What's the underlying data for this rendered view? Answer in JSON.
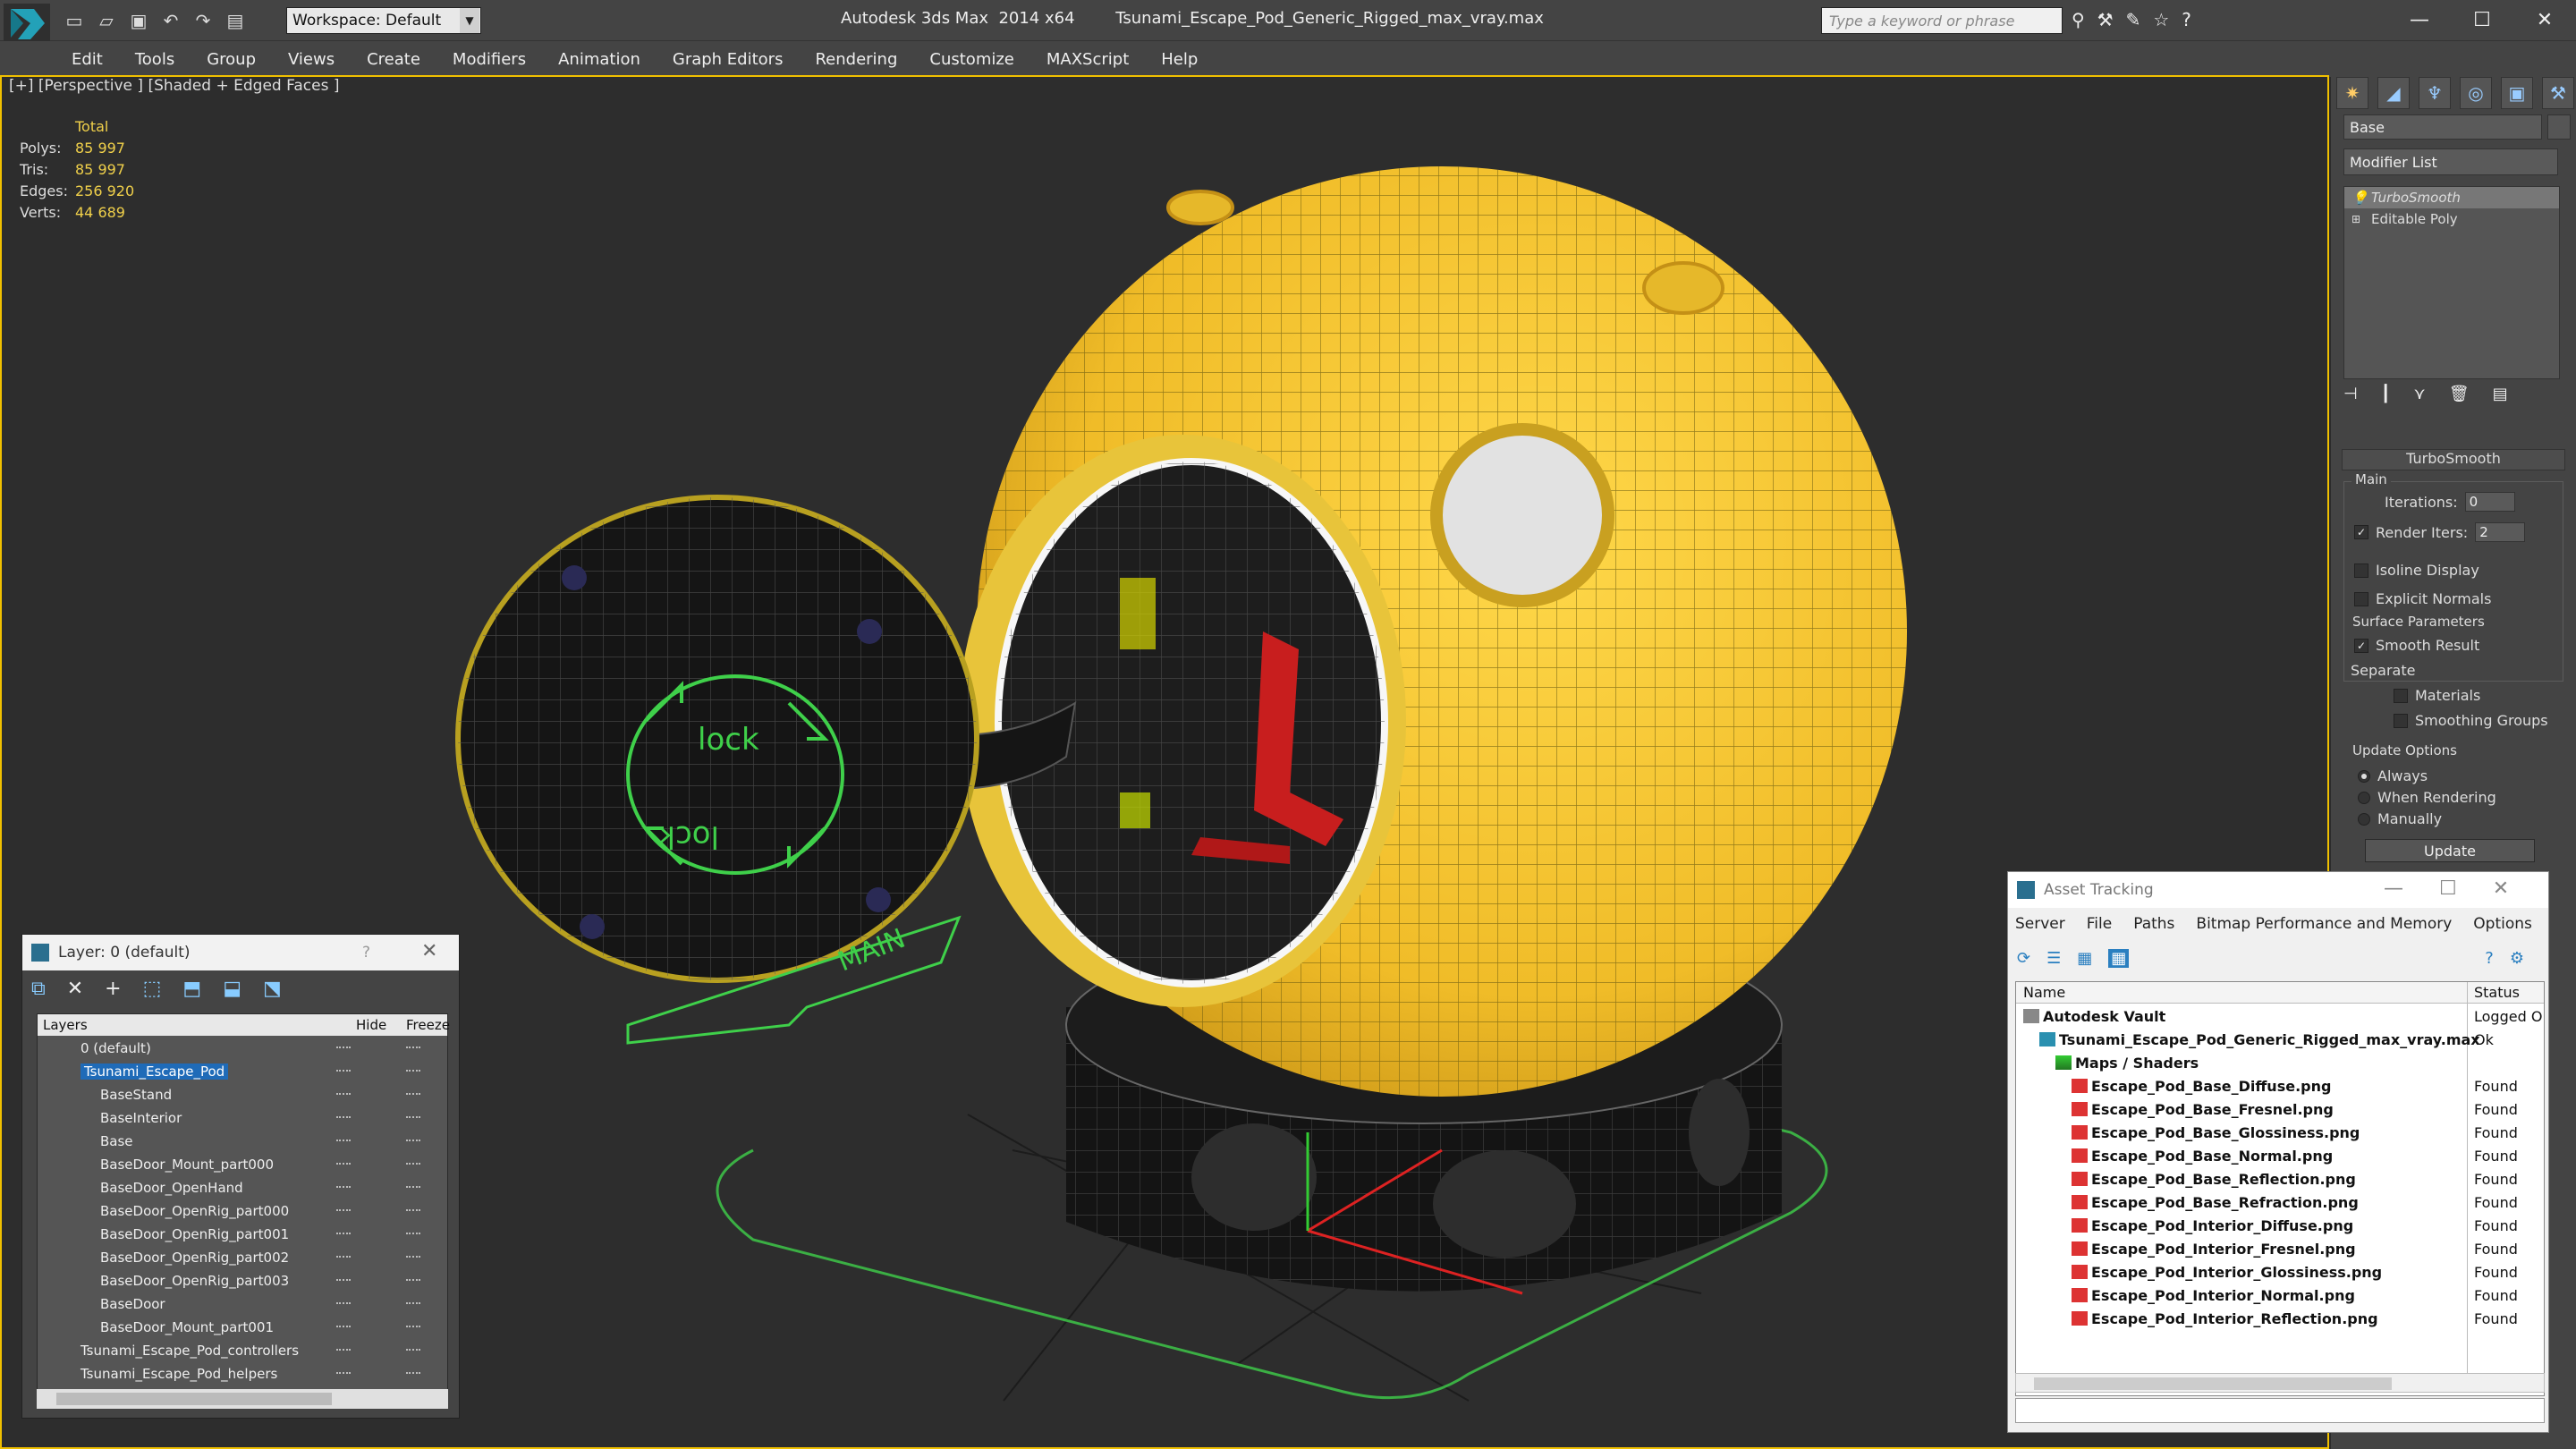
{
  "app": {
    "title": "Autodesk 3ds Max  2014 x64        Tsunami_Escape_Pod_Generic_Rigged_max_vray.max",
    "workspace": "Workspace: Default",
    "search_placeholder": "Type a keyword or phrase"
  },
  "menu": [
    "Edit",
    "Tools",
    "Group",
    "Views",
    "Create",
    "Modifiers",
    "Animation",
    "Graph Editors",
    "Rendering",
    "Customize",
    "MAXScript",
    "Help"
  ],
  "viewport": {
    "label": "[+] [Perspective ] [Shaded + Edged Faces ]",
    "stats_header": "Total",
    "stats": [
      {
        "label": "Polys:",
        "value": "85 997"
      },
      {
        "label": "Tris:",
        "value": "85 997"
      },
      {
        "label": "Edges:",
        "value": "256 920"
      },
      {
        "label": "Verts:",
        "value": "44 689"
      }
    ],
    "lock_top": "lock",
    "lock_bottom": "lock",
    "main_label": "MAIN"
  },
  "command_panel": {
    "object_name": "Base",
    "modifier_list": "Modifier List",
    "stack": [
      "TurboSmooth",
      "Editable Poly"
    ],
    "rollout_title": "TurboSmooth",
    "main_group": "Main",
    "iterations_label": "Iterations:",
    "iterations_value": "0",
    "render_iters_label": "Render Iters:",
    "render_iters_value": "2",
    "isoline": "Isoline Display",
    "explicit_normals": "Explicit Normals",
    "surface_params": "Surface Parameters",
    "smooth_result": "Smooth Result",
    "separate": "Separate",
    "materials": "Materials",
    "smoothing_groups": "Smoothing Groups",
    "update_options": "Update Options",
    "always": "Always",
    "when_rendering": "When Rendering",
    "manually": "Manually",
    "update_button": "Update"
  },
  "layer_window": {
    "title": "Layer: 0 (default)",
    "help": "?",
    "col_layers": "Layers",
    "col_hide": "Hide",
    "col_freeze": "Freeze",
    "rows": [
      {
        "name": "0 (default)",
        "indent": 0
      },
      {
        "name": "Tsunami_Escape_Pod",
        "indent": 0
      },
      {
        "name": "BaseStand",
        "indent": 1
      },
      {
        "name": "BaseInterior",
        "indent": 1
      },
      {
        "name": "Base",
        "indent": 1
      },
      {
        "name": "BaseDoor_Mount_part000",
        "indent": 1
      },
      {
        "name": "BaseDoor_OpenHand",
        "indent": 1
      },
      {
        "name": "BaseDoor_OpenRig_part000",
        "indent": 1
      },
      {
        "name": "BaseDoor_OpenRig_part001",
        "indent": 1
      },
      {
        "name": "BaseDoor_OpenRig_part002",
        "indent": 1
      },
      {
        "name": "BaseDoor_OpenRig_part003",
        "indent": 1
      },
      {
        "name": "BaseDoor",
        "indent": 1
      },
      {
        "name": "BaseDoor_Mount_part001",
        "indent": 1
      },
      {
        "name": "Tsunami_Escape_Pod_controllers",
        "indent": 0
      },
      {
        "name": "Tsunami_Escape_Pod_helpers",
        "indent": 0
      }
    ]
  },
  "asset_window": {
    "title": "Asset Tracking",
    "menu": [
      "Server",
      "File",
      "Paths",
      "Bitmap Performance and Memory",
      "Options"
    ],
    "col_name": "Name",
    "col_status": "Status",
    "rows": [
      {
        "name": "Autodesk Vault",
        "status": "Logged O",
        "icon": "vault",
        "indent": 0,
        "bold": true
      },
      {
        "name": "Tsunami_Escape_Pod_Generic_Rigged_max_vray.max",
        "status": "Ok",
        "icon": "max",
        "indent": 1,
        "bold": true
      },
      {
        "name": "Maps / Shaders",
        "status": "",
        "icon": "folder",
        "indent": 2,
        "bold": true
      },
      {
        "name": "Escape_Pod_Base_Diffuse.png",
        "status": "Found",
        "icon": "png",
        "indent": 3,
        "bold": true
      },
      {
        "name": "Escape_Pod_Base_Fresnel.png",
        "status": "Found",
        "icon": "png",
        "indent": 3,
        "bold": true
      },
      {
        "name": "Escape_Pod_Base_Glossiness.png",
        "status": "Found",
        "icon": "png",
        "indent": 3,
        "bold": true
      },
      {
        "name": "Escape_Pod_Base_Normal.png",
        "status": "Found",
        "icon": "png",
        "indent": 3,
        "bold": true
      },
      {
        "name": "Escape_Pod_Base_Reflection.png",
        "status": "Found",
        "icon": "png",
        "indent": 3,
        "bold": true
      },
      {
        "name": "Escape_Pod_Base_Refraction.png",
        "status": "Found",
        "icon": "png",
        "indent": 3,
        "bold": true
      },
      {
        "name": "Escape_Pod_Interior_Diffuse.png",
        "status": "Found",
        "icon": "png",
        "indent": 3,
        "bold": true
      },
      {
        "name": "Escape_Pod_Interior_Fresnel.png",
        "status": "Found",
        "icon": "png",
        "indent": 3,
        "bold": true
      },
      {
        "name": "Escape_Pod_Interior_Glossiness.png",
        "status": "Found",
        "icon": "png",
        "indent": 3,
        "bold": true
      },
      {
        "name": "Escape_Pod_Interior_Normal.png",
        "status": "Found",
        "icon": "png",
        "indent": 3,
        "bold": true
      },
      {
        "name": "Escape_Pod_Interior_Reflection.png",
        "status": "Found",
        "icon": "png",
        "indent": 3,
        "bold": true
      }
    ]
  },
  "colors": {
    "pod_yellow": "#f2c230",
    "selection_blue": "#1f6bb8",
    "viewport_border": "#f0c000",
    "helper_green": "#3fd04a"
  }
}
